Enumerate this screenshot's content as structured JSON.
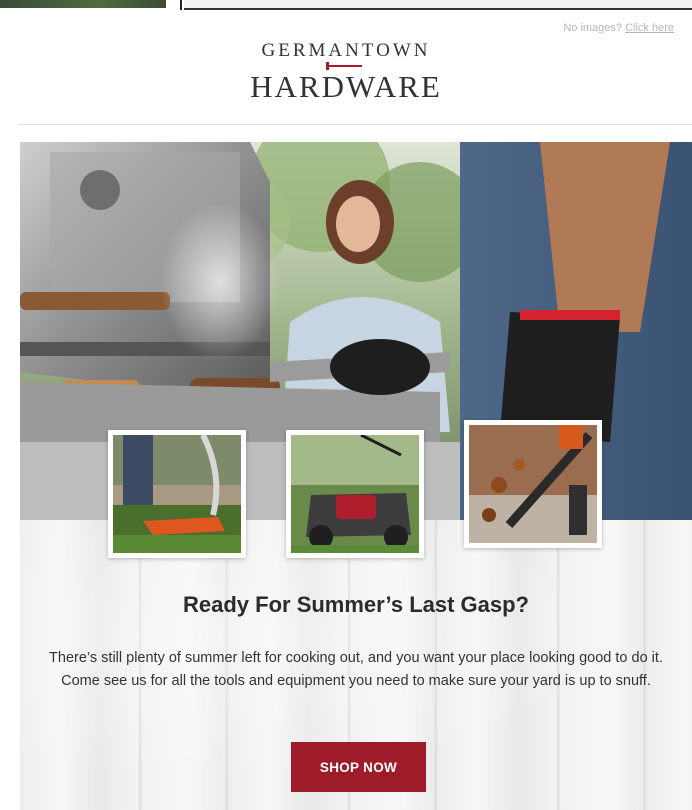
{
  "header": {
    "no_images_text": "No images? ",
    "click_here_link": "Click here"
  },
  "logo": {
    "top_word": "GERMANTOWN",
    "bottom_word": "HARDWARE",
    "accent_color": "#a51d2d"
  },
  "hero": {
    "icon": "grill-photo"
  },
  "products": [
    {
      "icon": "string-trimmer-photo"
    },
    {
      "icon": "lawn-mower-photo"
    },
    {
      "icon": "leaf-blower-photo"
    }
  ],
  "content": {
    "headline": "Ready For Summer’s Last Gasp?",
    "body": "There’s still plenty of summer left for cooking out, and you want your place looking good to do it. Come see us for all the tools and equipment you need to make sure your yard is up to snuff.",
    "cta_label": "SHOP NOW",
    "cta_color": "#9e1b2a"
  }
}
